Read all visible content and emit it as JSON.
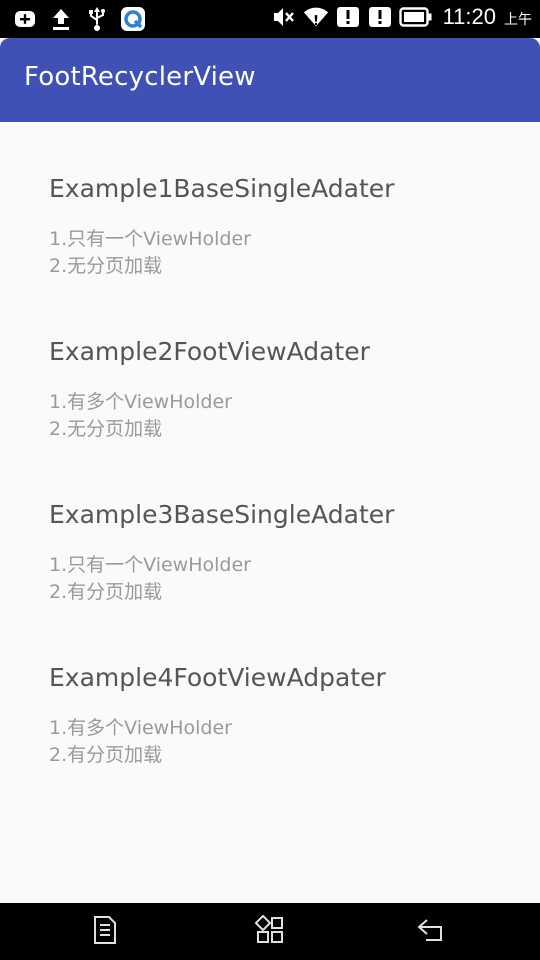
{
  "status_bar": {
    "time": "11:20",
    "am_pm": "上午",
    "colors": {
      "background": "#000000",
      "icon": "#ffffff"
    },
    "icons_left": [
      "add-box-icon",
      "upload-arrow-icon",
      "usb-icon",
      "q-app-icon"
    ],
    "icons_right": [
      "mute-icon",
      "wifi-icon",
      "alert-icon",
      "alert-icon",
      "battery-icon"
    ]
  },
  "app_bar": {
    "title": "FootRecyclerView",
    "color": "#3f51b5"
  },
  "list": {
    "items": [
      {
        "title": "Example1BaseSingleAdater",
        "line1": "1.只有一个ViewHolder",
        "line2": "2.无分页加载"
      },
      {
        "title": "Example2FootViewAdater",
        "line1": "1.有多个ViewHolder",
        "line2": "2.无分页加载"
      },
      {
        "title": "Example3BaseSingleAdater",
        "line1": "1.只有一个ViewHolder",
        "line2": "2.有分页加载"
      },
      {
        "title": "Example4FootViewAdpater",
        "line1": "1.有多个ViewHolder",
        "line2": "2.有分页加载"
      }
    ]
  },
  "nav_bar": {
    "buttons": [
      "menu-icon",
      "home-grid-icon",
      "back-icon"
    ]
  }
}
